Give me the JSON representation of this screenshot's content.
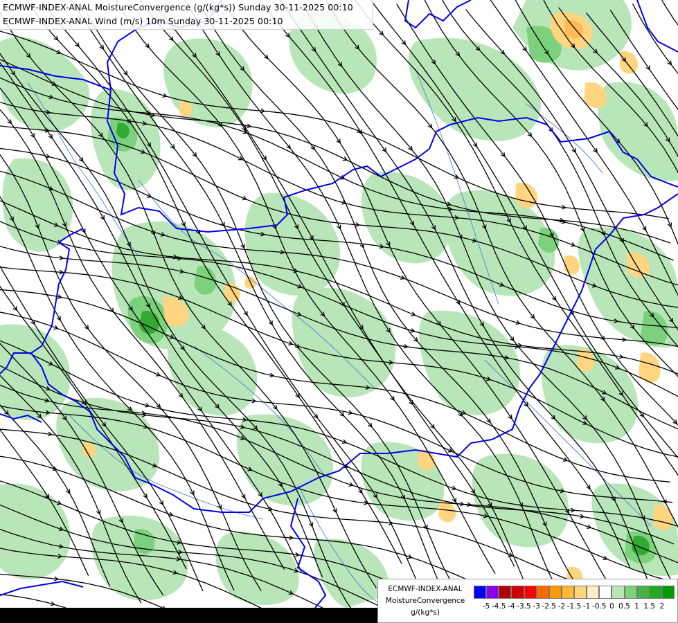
{
  "titles": {
    "line1": "ECMWF-INDEX-ANAL MoistureConvergence (g/(kg*s)) Sunday 30-11-2025 00:10",
    "line2": "ECMWF-INDEX-ANAL Wind (m/s) 10m Sunday 30-11-2025 00:10"
  },
  "legend": {
    "name_line1": "ECMWF-INDEX-ANAL",
    "name_line2": "MoistureConvergence",
    "unit": "g/(kg*s)",
    "ticks": [
      "-5",
      "-4.5",
      "-4",
      "-3.5",
      "-3",
      "-2.5",
      "-2",
      "-1.5",
      "-1",
      "-0.5",
      "0",
      "0.5",
      "1",
      "1.5",
      "2"
    ],
    "colors": [
      "#0000ff",
      "#8800ee",
      "#b00000",
      "#d40000",
      "#ff0000",
      "#ff6a00",
      "#ff9900",
      "#ffbb33",
      "#ffd580",
      "#ffeecc",
      "#ffffff",
      "#b8e6b8",
      "#7cd17c",
      "#44b444",
      "#22aa22",
      "#009900"
    ]
  },
  "map": {
    "layers": [
      "moisture-convergence-shading",
      "wind-streamlines",
      "country-borders",
      "rivers"
    ],
    "colors": {
      "convergence_light": "#b8e6b8",
      "convergence_mid": "#7cd17c",
      "convergence_strong": "#33a833",
      "divergence_light": "#ffd580",
      "divergence_mid": "#ffbb55",
      "border": "#0000ee",
      "river": "#4f7fd6",
      "streamline": "#000000"
    }
  }
}
